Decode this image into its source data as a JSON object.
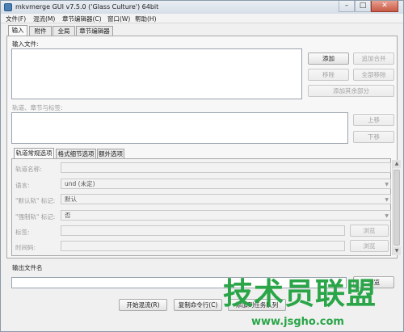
{
  "window": {
    "title": "mkvmerge GUI v7.5.0 ('Glass Culture') 64bit",
    "minimize": "–",
    "maximize": "□",
    "close": "✕"
  },
  "menubar": [
    "文件(F)",
    "混流(M)",
    "章节编辑器(C)",
    "窗口(W)",
    "帮助(H)"
  ],
  "main_tabs": [
    "输入",
    "附件",
    "全局",
    "章节编辑器"
  ],
  "input": {
    "files_label": "输入文件:",
    "buttons": {
      "add": "添加",
      "append": "追加合并",
      "remove": "移除",
      "remove_all": "全部移除",
      "add_other": "添加其余部分"
    },
    "tracks_label": "轨道、章节与标签:",
    "up": "上移",
    "down": "下移"
  },
  "sub_tabs": [
    "轨道常规选项",
    "格式细节选项",
    "额外选项"
  ],
  "track_options": {
    "track_name_label": "轨道名称:",
    "language_label": "语言:",
    "language_value": "und (未定)",
    "default_flag_label": "\"默认轨\" 标记:",
    "default_flag_value": "默认",
    "forced_flag_label": "\"强制轨\" 标记:",
    "forced_flag_value": "否",
    "tags_label": "标签:",
    "timecodes_label": "时间码:",
    "browse": "浏览"
  },
  "output": {
    "label": "输出文件名",
    "browse": "浏览"
  },
  "actions": {
    "start": "开始混流(R)",
    "copy": "复制命令行(C)",
    "add_to_queue": "添加到任务队列"
  },
  "watermark": {
    "text": "技术员联盟",
    "url": "www.jsgho.com"
  },
  "colors": {
    "watermark": "#2aa548",
    "window_bg": "#f0f0f0",
    "close": "#c75a45"
  }
}
